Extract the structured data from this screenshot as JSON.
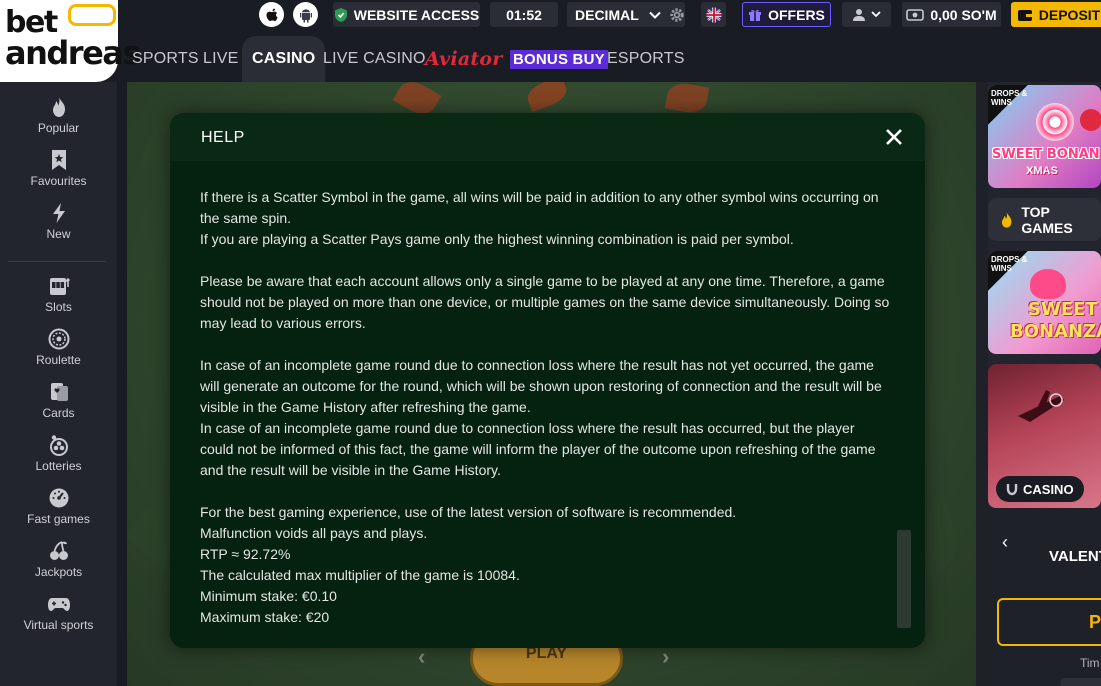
{
  "logo": {
    "line1": "bet",
    "line2": "andreas"
  },
  "topbar": {
    "website_access": "WEBSITE ACCESS",
    "time": "01:52",
    "odds_format": "DECIMAL",
    "offers": "OFFERS",
    "balance": "0,00 SO'M",
    "deposit": "DEPOSIT"
  },
  "nav": {
    "sports": "SPORTS",
    "live": "LIVE",
    "casino": "CASINO",
    "live_casino": "LIVE CASINO",
    "aviator": "Aviator",
    "bonus_buy": "BONUS BUY",
    "esports": "ESPORTS"
  },
  "sidebar": {
    "items": [
      {
        "label": "Popular",
        "icon": "flame-icon"
      },
      {
        "label": "Favourites",
        "icon": "bookmark-star-icon"
      },
      {
        "label": "New",
        "icon": "lightning-icon"
      },
      {
        "label": "Slots",
        "icon": "slot-machine-icon"
      },
      {
        "label": "Roulette",
        "icon": "roulette-icon"
      },
      {
        "label": "Cards",
        "icon": "cards-icon"
      },
      {
        "label": "Lotteries",
        "icon": "lottery-balls-icon"
      },
      {
        "label": "Fast games",
        "icon": "speedometer-icon"
      },
      {
        "label": "Jackpots",
        "icon": "cherries-icon"
      },
      {
        "label": "Virtual sports",
        "icon": "gamepad-icon"
      }
    ]
  },
  "game": {
    "play_label": "PLAY"
  },
  "help": {
    "title": "HELP",
    "paragraphs": [
      [
        "If there is a Scatter Symbol in the game, all wins will be paid in addition to any other symbol wins occurring on the same spin.",
        "If you are playing a Scatter Pays game only the highest winning combination is paid per symbol."
      ],
      [
        "Please be aware that each account allows only a single game to be played at any one time. Therefore, a game should not be played on more than one device, or multiple games on the same device simultaneously. Doing so may lead to various errors."
      ],
      [
        "In case of an incomplete game round due to connection loss where the result has not yet occurred, the game will generate an outcome for the round, which will be shown upon restoring of connection and the result will be visible in the Game History after refreshing the game.",
        "In case of an incomplete game round due to connection loss where the result has occurred, but the player could not be informed of this fact, the game will inform the player of the outcome upon refreshing of the game and the result will be visible in the Game History."
      ],
      [
        "For the best gaming experience, use of the latest version of software is recommended.",
        "Malfunction voids all pays and plays.",
        "RTP ≈ 92.72%",
        "The calculated max multiplier of the game is 10084.",
        "Minimum stake: €0.10",
        "Maximum stake: €20"
      ]
    ]
  },
  "right": {
    "card1": {
      "provider_badge": "DROPS & WINS",
      "title": "SWEET BONAN",
      "subtitle": "XMAS"
    },
    "top_games": "TOP GAMES",
    "card2": {
      "provider_badge": "DROPS & WINS",
      "title1": "SWEET",
      "title2": "BONANZA"
    },
    "casino_badge": "CASINO",
    "promo": {
      "title": "VALENT",
      "button": "P",
      "timer": "Tim"
    }
  },
  "colors": {
    "accent": "#f5b800",
    "modal_bg": "#05210f",
    "offers_border": "#6d5cff",
    "bonus_buy": "#5a2bd6",
    "aviator": "#e0293a"
  }
}
